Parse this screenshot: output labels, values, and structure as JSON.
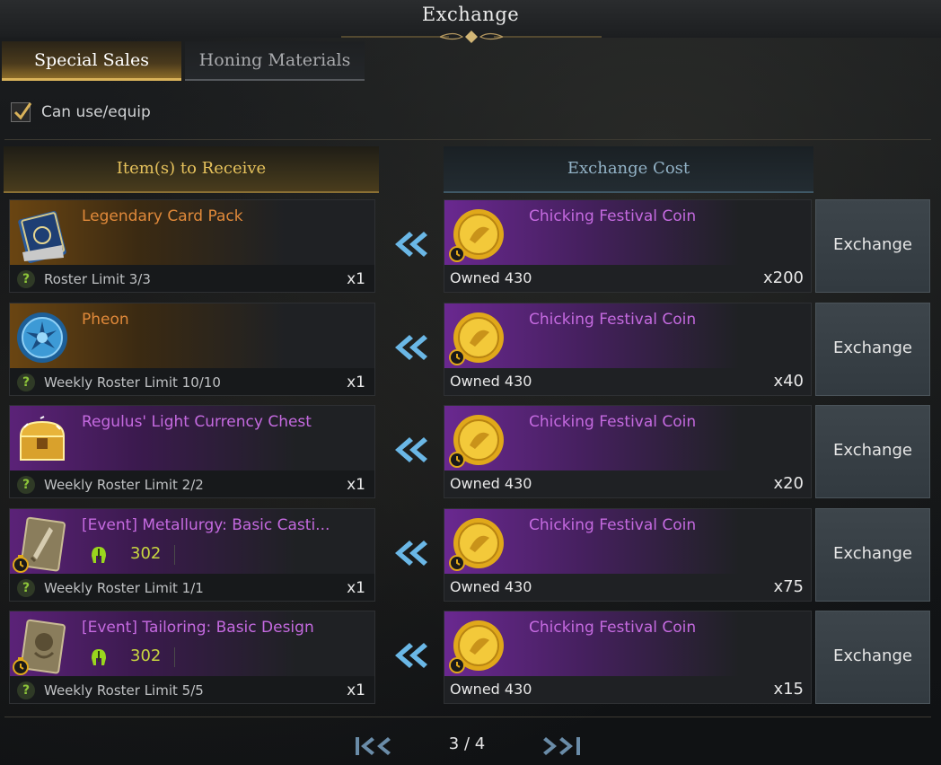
{
  "window": {
    "title": "Exchange"
  },
  "tabs": [
    {
      "label": "Special Sales",
      "active": true
    },
    {
      "label": "Honing Materials",
      "active": false
    }
  ],
  "filter": {
    "label": "Can use/equip",
    "checked": true
  },
  "columns": {
    "receive": "Item(s) to Receive",
    "cost": "Exchange Cost"
  },
  "rows": [
    {
      "item": {
        "name": "Legendary Card Pack",
        "grade": "legendary",
        "icon": "card-pack-icon",
        "limit": "Roster Limit 3/3",
        "qty": "x1"
      },
      "cost": {
        "name": "Chicking Festival Coin",
        "owned": "Owned 430",
        "qty": "x200"
      },
      "button": "Exchange"
    },
    {
      "item": {
        "name": "Pheon",
        "grade": "legendary",
        "icon": "pheon-icon",
        "limit": "Weekly Roster Limit 10/10",
        "qty": "x1"
      },
      "cost": {
        "name": "Chicking Festival Coin",
        "owned": "Owned 430",
        "qty": "x40"
      },
      "button": "Exchange"
    },
    {
      "item": {
        "name": "Regulus' Light Currency Chest",
        "grade": "epic",
        "icon": "treasure-chest-icon",
        "limit": "Weekly Roster Limit 2/2",
        "qty": "x1"
      },
      "cost": {
        "name": "Chicking Festival Coin",
        "owned": "Owned 430",
        "qty": "x20"
      },
      "button": "Exchange"
    },
    {
      "item": {
        "name": "[Event] Metallurgy: Basic Casti...",
        "grade": "epic",
        "icon": "metallurgy-book-icon",
        "requirement": "302",
        "limit": "Weekly Roster Limit 1/1",
        "qty": "x1"
      },
      "cost": {
        "name": "Chicking Festival Coin",
        "owned": "Owned 430",
        "qty": "x75"
      },
      "button": "Exchange"
    },
    {
      "item": {
        "name": "[Event] Tailoring: Basic Design",
        "grade": "epic",
        "icon": "tailoring-book-icon",
        "requirement": "302",
        "limit": "Weekly Roster Limit 5/5",
        "qty": "x1"
      },
      "cost": {
        "name": "Chicking Festival Coin",
        "owned": "Owned 430",
        "qty": "x15"
      },
      "button": "Exchange"
    }
  ],
  "pagination": {
    "current": "3 / 4"
  },
  "colors": {
    "legendary": "#e0893a",
    "epic": "#c56ae0",
    "gold_accent": "#d9b25a",
    "requirement": "#c8d640",
    "arrow": "#6ab7e6"
  }
}
